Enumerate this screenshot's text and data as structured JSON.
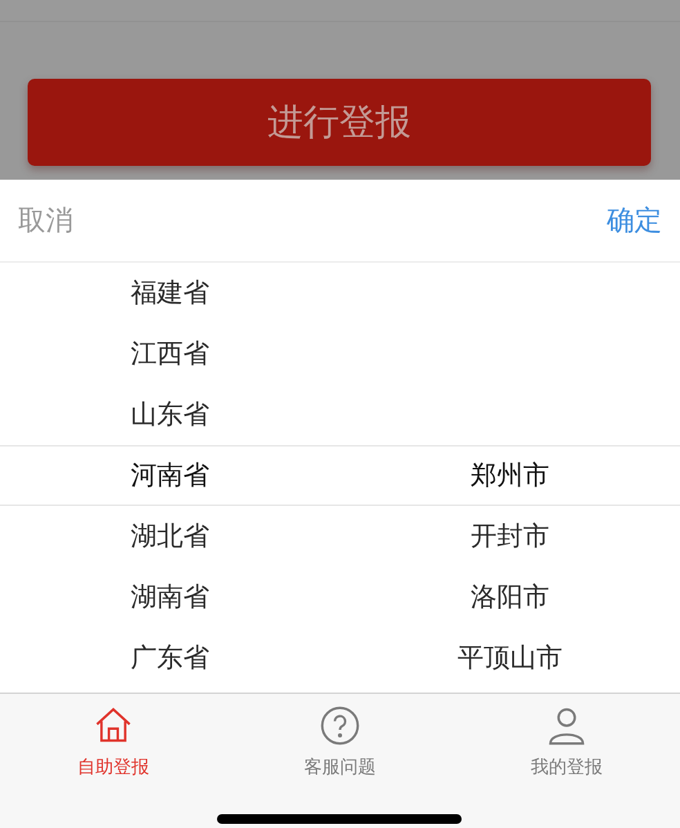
{
  "page": {
    "submit_button": "进行登报"
  },
  "picker": {
    "cancel": "取消",
    "confirm": "确定",
    "columns": [
      {
        "items": [
          {
            "label": "福建省",
            "selected": false
          },
          {
            "label": "江西省",
            "selected": false
          },
          {
            "label": "山东省",
            "selected": false
          },
          {
            "label": "河南省",
            "selected": true
          },
          {
            "label": "湖北省",
            "selected": false
          },
          {
            "label": "湖南省",
            "selected": false
          },
          {
            "label": "广东省",
            "selected": false
          }
        ]
      },
      {
        "items": [
          {
            "label": "郑州市",
            "selected": true
          },
          {
            "label": "开封市",
            "selected": false
          },
          {
            "label": "洛阳市",
            "selected": false
          },
          {
            "label": "平顶山市",
            "selected": false
          }
        ]
      }
    ]
  },
  "tab_bar": [
    {
      "kind": "home",
      "label": "自助登报",
      "selected": true
    },
    {
      "kind": "help",
      "label": "客服问题",
      "selected": false
    },
    {
      "kind": "user",
      "label": "我的登报",
      "selected": false
    }
  ]
}
